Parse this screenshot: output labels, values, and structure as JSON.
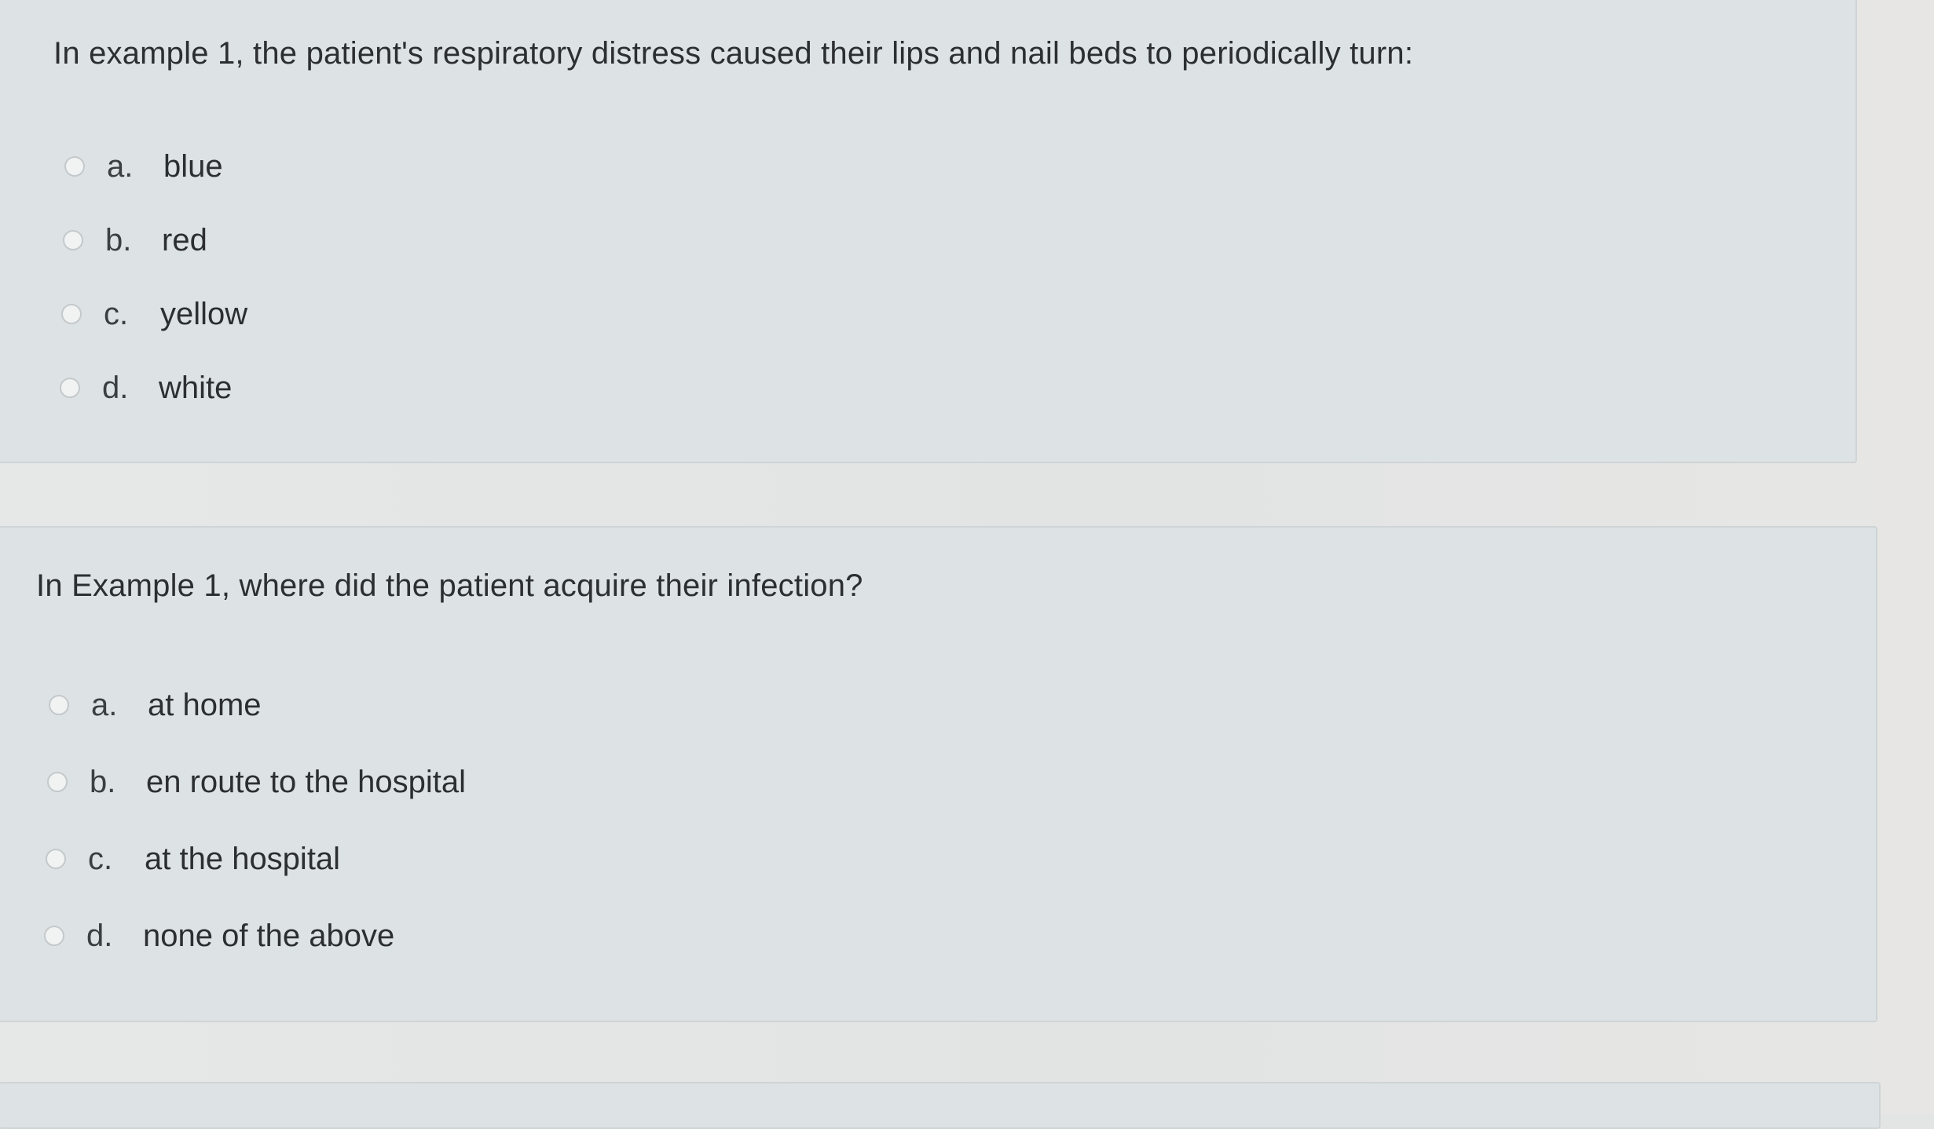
{
  "questions": [
    {
      "prompt": "In example 1, the patient's respiratory distress caused their lips and nail beds to periodically turn:",
      "options": [
        {
          "letter": "a.",
          "text": "blue"
        },
        {
          "letter": "b.",
          "text": "red"
        },
        {
          "letter": "c.",
          "text": "yellow"
        },
        {
          "letter": "d.",
          "text": "white"
        }
      ]
    },
    {
      "prompt": "In Example 1, where did the patient acquire their infection?",
      "options": [
        {
          "letter": "a.",
          "text": "at home"
        },
        {
          "letter": "b.",
          "text": "en route to the hospital"
        },
        {
          "letter": "c.",
          "text": "at the hospital"
        },
        {
          "letter": "d.",
          "text": "none of the above"
        }
      ]
    }
  ]
}
